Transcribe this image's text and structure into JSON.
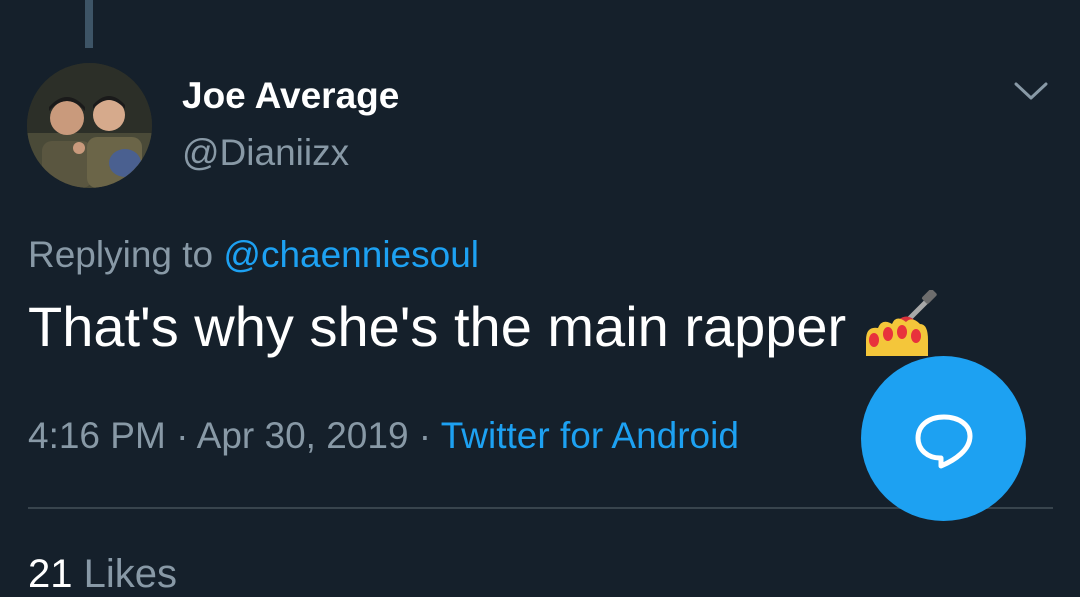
{
  "tweet": {
    "author": {
      "display_name": "Joe Average",
      "handle": "@Dianiizx"
    },
    "reply": {
      "prefix": "Replying to ",
      "mention": "@chaenniesoul"
    },
    "text": "That's why she's the main rapper",
    "emoji": "nail-polish-emoji",
    "time": "4:16 PM",
    "separator": " · ",
    "date": "Apr 30, 2019",
    "source": "Twitter for Android"
  },
  "stats": {
    "likes_count": "21",
    "likes_label": "Likes"
  },
  "fab": {
    "icon": "reply-bubble-icon"
  },
  "icons": {
    "menu": "chevron-down-icon"
  },
  "colors": {
    "background": "#15202b",
    "accent": "#1da1f2",
    "secondary_text": "#8899a6",
    "primary_text": "#ffffff",
    "divider": "#38444d"
  }
}
